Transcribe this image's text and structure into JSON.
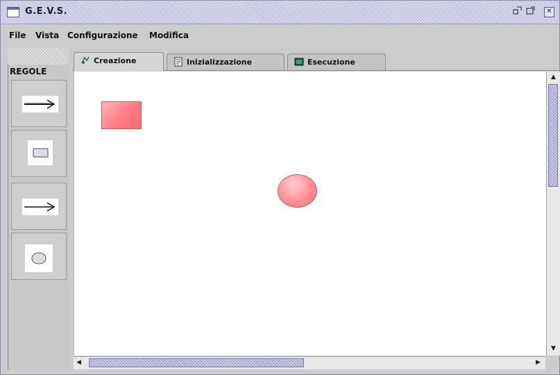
{
  "window": {
    "title": "G.E.V.S.",
    "controls": {
      "minimize": "▫",
      "maximize": "▫",
      "close": "✕"
    },
    "accent_color": "#c9c9e6"
  },
  "menubar": {
    "items": [
      {
        "label": "File"
      },
      {
        "label": "Vista"
      },
      {
        "label": "Configurazione"
      },
      {
        "label": "Modifica"
      }
    ]
  },
  "tabs": [
    {
      "label": "Creazione",
      "icon": "creation-icon",
      "active": true
    },
    {
      "label": "Inizializzazione",
      "icon": "init-icon",
      "active": false
    },
    {
      "label": "Esecuzione",
      "icon": "execute-icon",
      "active": false
    }
  ],
  "palette": {
    "title": "REGOLE",
    "tools": [
      {
        "name": "arrow-tool",
        "icon": "arrow-icon"
      },
      {
        "name": "rectangle-tool",
        "icon": "rectangle-icon"
      },
      {
        "name": "arrow-tool-2",
        "icon": "arrow-icon"
      },
      {
        "name": "ellipse-tool",
        "icon": "ellipse-icon"
      }
    ]
  },
  "canvas": {
    "shapes": [
      {
        "type": "rectangle",
        "fill": "#ff7d82"
      },
      {
        "type": "ellipse",
        "fill": "#ff8f96"
      }
    ]
  },
  "scrollbars": {
    "vertical": {
      "up": "▲",
      "down": "▼"
    },
    "horizontal": {
      "left": "◀",
      "right": "▶"
    }
  }
}
